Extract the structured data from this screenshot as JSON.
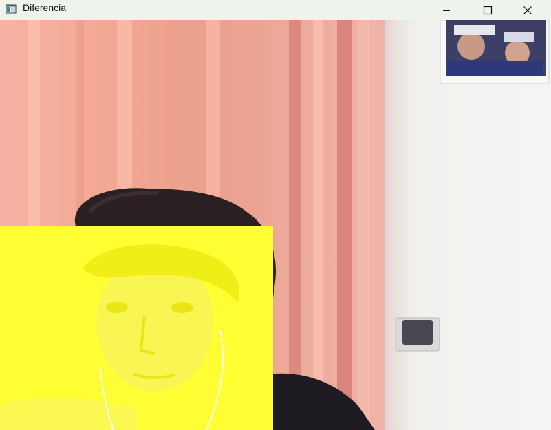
{
  "window": {
    "title": "Diferencia",
    "icon": "app-window-icon",
    "controls": [
      "minimize-icon",
      "maximize-icon",
      "close-icon"
    ]
  },
  "frame": {
    "description_colors": {
      "curtain": "#f2a58f",
      "curtain_dark": "#c9706a",
      "wall": "#eeeeec",
      "hair": "#2a1f22",
      "shirt": "#1e1b22",
      "overlay": "#ffff33"
    }
  }
}
